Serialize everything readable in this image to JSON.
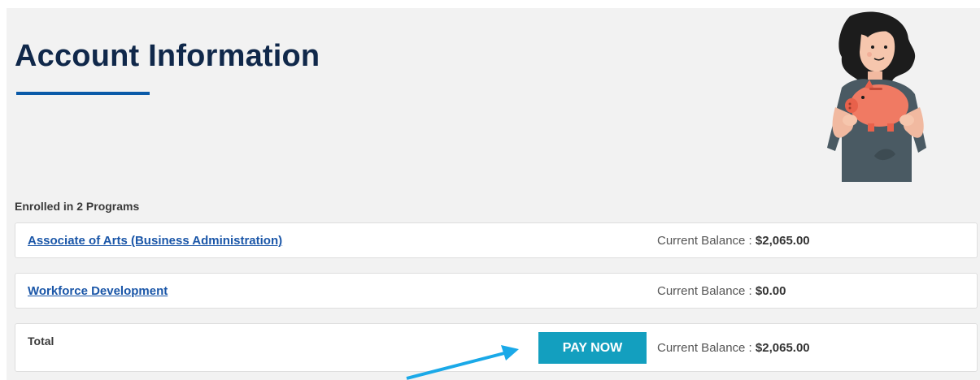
{
  "page": {
    "title": "Account Information",
    "enrolled_text": "Enrolled in 2 Programs"
  },
  "programs": [
    {
      "name": "Associate of Arts (Business Administration)",
      "balance_label": "Current Balance : ",
      "balance_value": "$2,065.00"
    },
    {
      "name": "Workforce Development",
      "balance_label": "Current Balance : ",
      "balance_value": "$0.00"
    }
  ],
  "total": {
    "label": "Total",
    "pay_button": "PAY NOW",
    "balance_label": "Current Balance : ",
    "balance_value": "$2,065.00"
  },
  "colors": {
    "title": "#10284a",
    "underline": "#0a5aa8",
    "link": "#1a56a8",
    "pay_button": "#139fbf",
    "arrow": "#1aa9e8"
  },
  "icons": {
    "illustration": "woman-holding-piggy-bank-illustration",
    "arrow": "annotation-arrow-icon"
  }
}
